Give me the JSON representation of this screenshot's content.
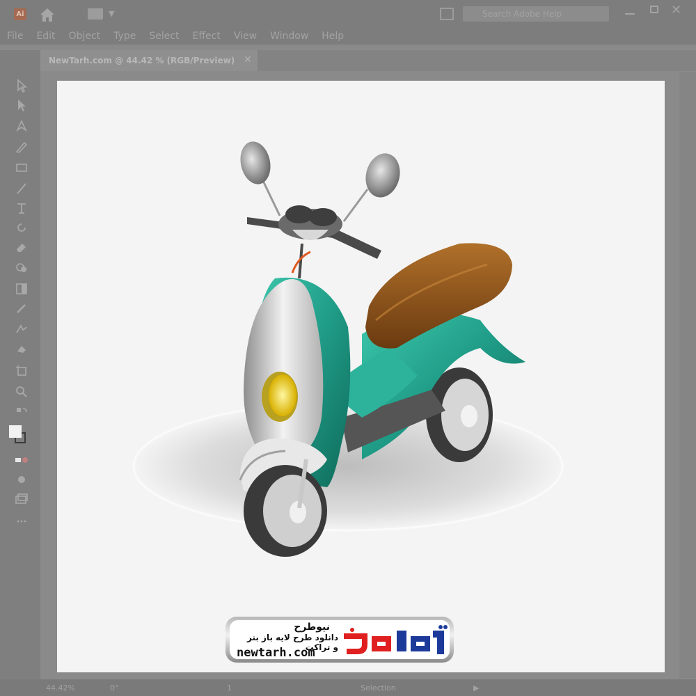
{
  "app": {
    "logo_text": "Ai"
  },
  "menu": [
    "File",
    "Edit",
    "Object",
    "Type",
    "Select",
    "Effect",
    "View",
    "Window",
    "Help"
  ],
  "search": {
    "placeholder": "Search Adobe Help"
  },
  "document_tab": {
    "title": "NewTarh.com @ 44.42 % (RGB/Preview)"
  },
  "status": {
    "zoom": "44.42%",
    "angle": "0°",
    "page": "1",
    "tool": "Selection"
  },
  "watermark": {
    "title": "نیوطرح",
    "subtitle": "دانلود طرح لایه باز بنر و تراکت",
    "url": "newtarh.com",
    "logo_text": "نیوطرح"
  },
  "colors": {
    "scooter_body": "#1e9b86",
    "seat": "#8a4f1a",
    "headlight": "#f0d21a",
    "logo_red": "#e02020",
    "logo_blue": "#1d3a9b"
  }
}
